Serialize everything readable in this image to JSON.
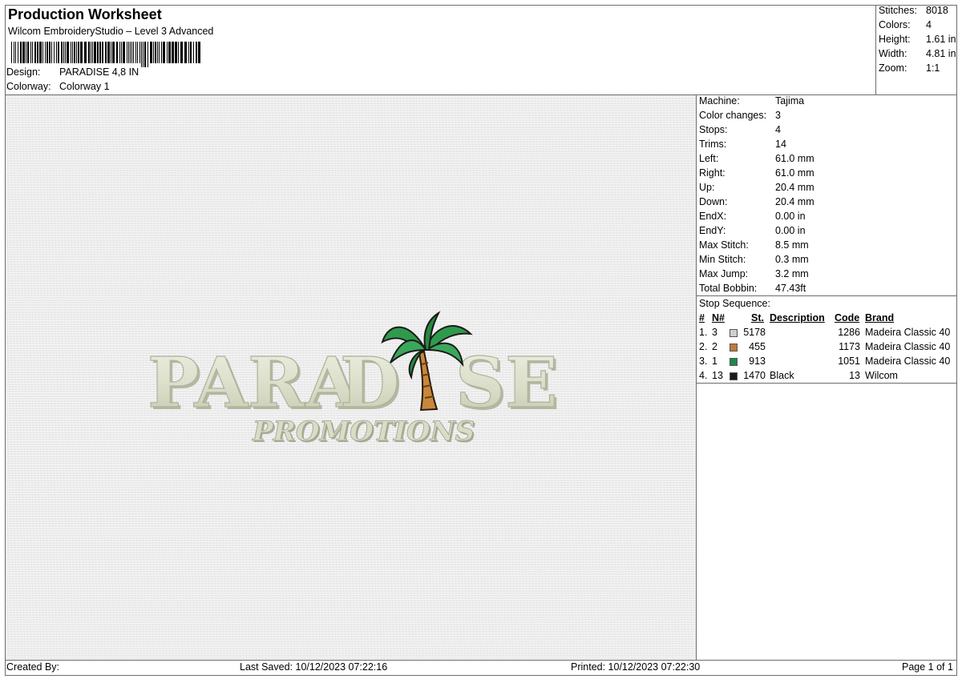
{
  "header": {
    "title": "Production Worksheet",
    "subtitle": "Wilcom EmbroideryStudio – Level 3 Advanced",
    "design_label": "Design:",
    "design_value": "PARADISE 4,8 IN",
    "colorway_label": "Colorway:",
    "colorway_value": "Colorway 1"
  },
  "stats": [
    {
      "label": "Stitches:",
      "value": "8018"
    },
    {
      "label": "Colors:",
      "value": "4"
    },
    {
      "label": "Height:",
      "value": "1.61 in"
    },
    {
      "label": "Width:",
      "value": "4.81 in"
    },
    {
      "label": "Zoom:",
      "value": "1:1"
    }
  ],
  "machine_info": [
    {
      "label": "Machine:",
      "value": "Tajima"
    },
    {
      "label": "Color changes:",
      "value": "3"
    },
    {
      "label": "Stops:",
      "value": "4"
    },
    {
      "label": "Trims:",
      "value": "14"
    },
    {
      "label": "Left:",
      "value": "61.0 mm"
    },
    {
      "label": "Right:",
      "value": "61.0 mm"
    },
    {
      "label": "Up:",
      "value": "20.4 mm"
    },
    {
      "label": "Down:",
      "value": "20.4 mm"
    },
    {
      "label": "EndX:",
      "value": "0.00 in"
    },
    {
      "label": "EndY:",
      "value": "0.00 in"
    },
    {
      "label": "Max Stitch:",
      "value": "8.5 mm"
    },
    {
      "label": "Min Stitch:",
      "value": "0.3 mm"
    },
    {
      "label": "Max Jump:",
      "value": "3.2 mm"
    },
    {
      "label": "Total Bobbin:",
      "value": "47.43ft"
    }
  ],
  "stop_sequence": {
    "label": "Stop Sequence:",
    "columns": {
      "num": "#",
      "n": "N#",
      "st": "St.",
      "description": "Description",
      "code": "Code",
      "brand": "Brand"
    },
    "rows": [
      {
        "num": "1.",
        "n": "3",
        "color": "#cfcfcf",
        "st": "5178",
        "description": "",
        "code": "1286",
        "brand": "Madeira Classic 40"
      },
      {
        "num": "2.",
        "n": "2",
        "color": "#c07a3a",
        "st": "455",
        "description": "",
        "code": "1173",
        "brand": "Madeira Classic 40"
      },
      {
        "num": "3.",
        "n": "1",
        "color": "#1a8a4a",
        "st": "913",
        "description": "",
        "code": "1051",
        "brand": "Madeira Classic 40"
      },
      {
        "num": "4.",
        "n": "13",
        "color": "#1a1a1a",
        "st": "1470",
        "description": "Black",
        "code": "13",
        "brand": "Wilcom"
      }
    ]
  },
  "design_art": {
    "main_text": "PARA",
    "d_letter": "D",
    "end_text": "SE",
    "sub_text": "PROMOTIONS",
    "thread_color": "#dfe3d0",
    "shadow_color": "#a9ae98",
    "leaf_color": "#2f9a4c",
    "trunk_color": "#c8873c"
  },
  "footer": {
    "created_by": "Created By:",
    "last_saved": "Last Saved: 10/12/2023 07:22:16",
    "printed": "Printed: 10/12/2023 07:22:30",
    "page": "Page 1 of 1"
  }
}
